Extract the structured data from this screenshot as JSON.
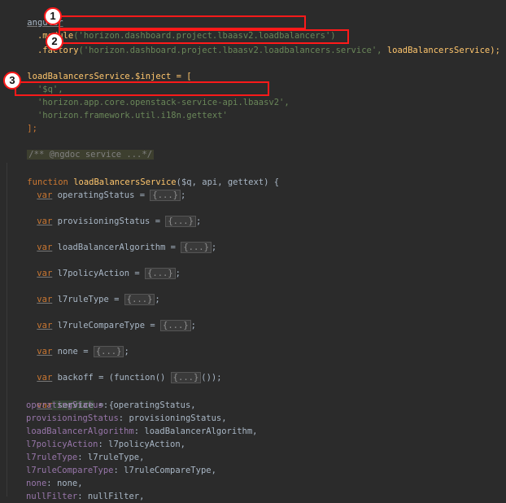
{
  "code": {
    "l1_angular": "angular",
    "l2_module_kw": "  .module",
    "l2_module_arg": "('horizon.dashboard.project.lbaasv2.loadbalancers')",
    "l3_factory_kw": "  .factory",
    "l3_factory_arg": "('horizon.dashboard.project.lbaasv2.loadbalancers.service',",
    "l3_factory_tail": " loadBalancersService);",
    "l5_inject": "loadBalancersService.$inject = [",
    "l6_q": "  '$q',",
    "l7_api": "  'horizon.app.core.openstack-service-api.lbaasv2',",
    "l8_gettext": "  'horizon.framework.util.i18n.gettext'",
    "l9_close": "];",
    "l11_comment": "/** @ngdoc service ...*/",
    "l13_fn_kw": "function ",
    "l13_fn_name": "loadBalancersService",
    "l13_fn_params": "($q, api, gettext) {",
    "var_kw": "var",
    "vars": [
      {
        "name": " operatingStatus = ",
        "fold": "{...}",
        "tail": ";"
      },
      {
        "name": " provisioningStatus = ",
        "fold": "{...}",
        "tail": ";"
      },
      {
        "name": " loadBalancerAlgorithm = ",
        "fold": "{...}",
        "tail": ";"
      },
      {
        "name": " l7policyAction = ",
        "fold": "{...}",
        "tail": ";"
      },
      {
        "name": " l7ruleType = ",
        "fold": "{...}",
        "tail": ";"
      },
      {
        "name": " l7ruleCompareType = ",
        "fold": "{...}",
        "tail": ";"
      },
      {
        "name": " none = ",
        "fold": "{...}",
        "tail": ";"
      },
      {
        "name": " backoff = (function() ",
        "fold": "{...}",
        "tail": "());"
      }
    ],
    "service_kw": "var",
    "service_name": " service",
    "service_tail": " = {",
    "service_props": [
      {
        "key": "operatingStatus",
        "val": " operatingStatus,"
      },
      {
        "key": "provisioningStatus",
        "val": " provisioningStatus,"
      },
      {
        "key": "loadBalancerAlgorithm",
        "val": " loadBalancerAlgorithm,"
      },
      {
        "key": "l7policyAction",
        "val": " l7policyAction,"
      },
      {
        "key": "l7ruleType",
        "val": " l7ruleType,"
      },
      {
        "key": "l7ruleCompareType",
        "val": " l7ruleCompareType,"
      },
      {
        "key": "none",
        "val": " none,"
      },
      {
        "key": "nullFilter",
        "val": " nullFilter,"
      }
    ]
  },
  "annotations": {
    "badge1": "1",
    "badge2": "2",
    "badge3": "3",
    "box_color": "#ff1a1a"
  }
}
